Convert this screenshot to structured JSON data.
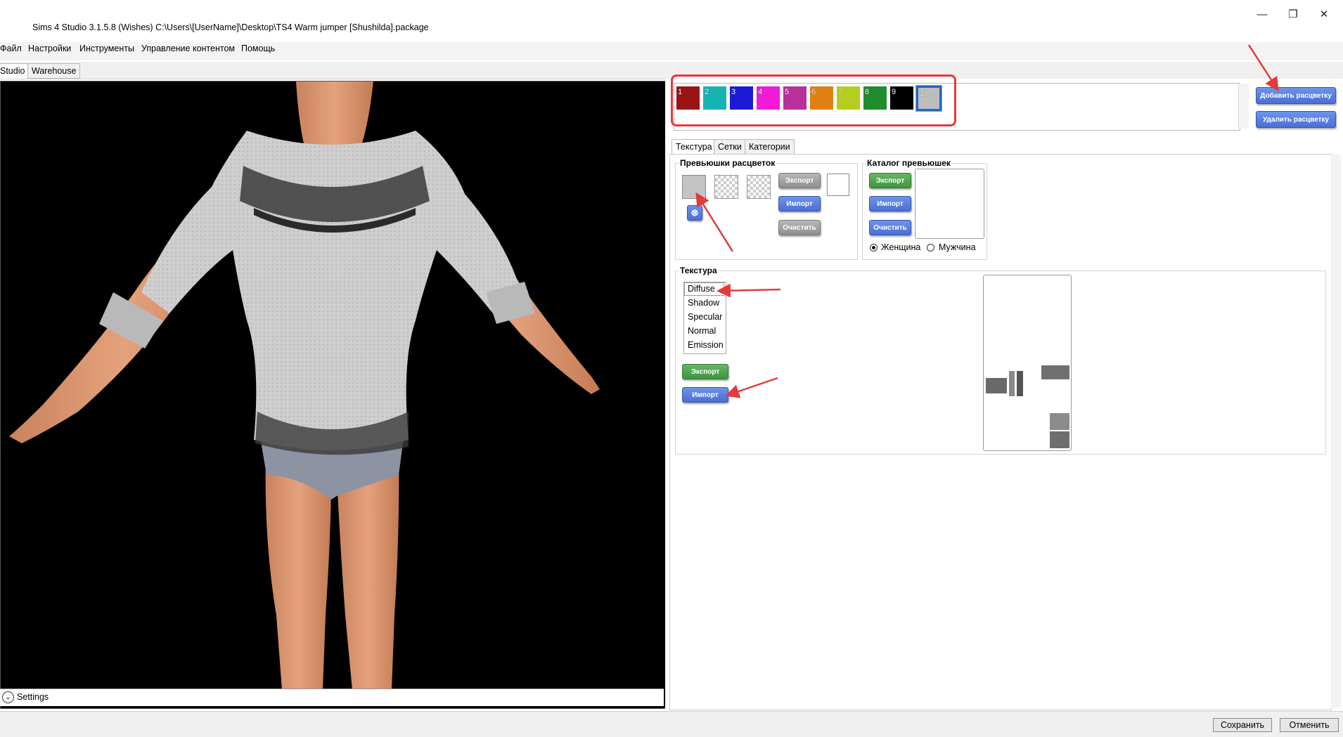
{
  "window": {
    "title": "Sims 4 Studio 3.1.5.8 (Wishes)  C:\\Users\\[UserName]\\Desktop\\TS4 Warm jumper [Shushilda].package",
    "controls": {
      "minimize": "—",
      "maximize": "❐",
      "close": "✕"
    }
  },
  "menu": [
    "Файл",
    "Настройки",
    "Инструменты",
    "Управление контентом",
    "Помощь"
  ],
  "top_tabs": [
    "Studio",
    "Warehouse"
  ],
  "viewport": {
    "settings_label": "Settings",
    "settings_toggle": "⌄"
  },
  "swatches": [
    {
      "label": "1",
      "color": "#9b1414"
    },
    {
      "label": "2",
      "color": "#16b3b3"
    },
    {
      "label": "3",
      "color": "#1a1ad6"
    },
    {
      "label": "4",
      "color": "#f01ad8"
    },
    {
      "label": "5",
      "color": "#b8309a"
    },
    {
      "label": "6",
      "color": "#e08012"
    },
    {
      "label": "7",
      "color": "#b5cd1e"
    },
    {
      "label": "8",
      "color": "#1f8c2d"
    },
    {
      "label": "9",
      "color": "#000000"
    },
    {
      "label": "10",
      "color": "#bdbdbd"
    }
  ],
  "swatch_buttons": {
    "add": "Добавить расцветку",
    "remove": "Удалить расцветку"
  },
  "sub_tabs": [
    "Текстура",
    "Сетки",
    "Категории"
  ],
  "thumbs_group": {
    "title": "Превьюшки расцветок",
    "export": "Экспорт",
    "import": "Импорт",
    "clear": "Очистить",
    "remove_icon": "⊗"
  },
  "catalog_group": {
    "title": "Каталог превьюшек",
    "export": "Экспорт",
    "import": "Импорт",
    "clear": "Очистить",
    "female": "Женщина",
    "male": "Мужчина",
    "selected_gender": "female"
  },
  "texture_group": {
    "title": "Текстура",
    "items": [
      "Diffuse",
      "Shadow",
      "Specular",
      "Normal",
      "Emission"
    ],
    "selected": "Diffuse",
    "export": "Экспорт",
    "import": "Импорт"
  },
  "bottom_buttons": {
    "save": "Сохранить",
    "cancel": "Отменить"
  },
  "colors": {
    "accent_blue": "#4a6fd6",
    "export_green": "#3f963f",
    "annotation_red": "#e23b3b",
    "selection_blue": "#1c69c9"
  }
}
